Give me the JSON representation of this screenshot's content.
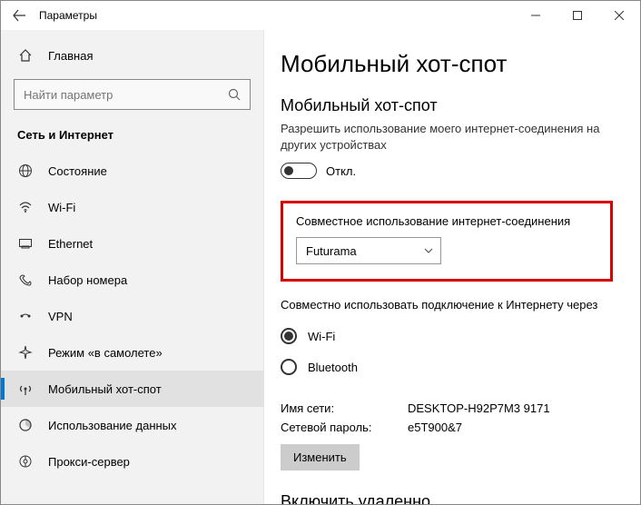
{
  "titlebar": {
    "title": "Параметры"
  },
  "sidebar": {
    "home_label": "Главная",
    "search_placeholder": "Найти параметр",
    "category": "Сеть и Интернет",
    "items": [
      {
        "label": "Состояние"
      },
      {
        "label": "Wi-Fi"
      },
      {
        "label": "Ethernet"
      },
      {
        "label": "Набор номера"
      },
      {
        "label": "VPN"
      },
      {
        "label": "Режим «в самолете»"
      },
      {
        "label": "Мобильный хот-спот"
      },
      {
        "label": "Использование данных"
      },
      {
        "label": "Прокси-сервер"
      }
    ]
  },
  "content": {
    "page_title": "Мобильный хот-спот",
    "hotspot": {
      "title": "Мобильный хот-спот",
      "desc": "Разрешить использование моего интернет-соединения на других устройствах",
      "toggle_label": "Откл."
    },
    "share": {
      "label": "Совместное использование интернет-соединения",
      "dropdown_value": "Futurama"
    },
    "via": {
      "label": "Совместно использовать подключение к Интернету через",
      "options": {
        "wifi": "Wi-Fi",
        "bt": "Bluetooth"
      }
    },
    "info": {
      "name_key": "Имя сети:",
      "name_val": "DESKTOP-H92P7M3 9171",
      "pass_key": "Сетевой пароль:",
      "pass_val": "e5T900&7",
      "edit_btn": "Изменить"
    },
    "remote": {
      "title": "Включить удаленно"
    }
  }
}
